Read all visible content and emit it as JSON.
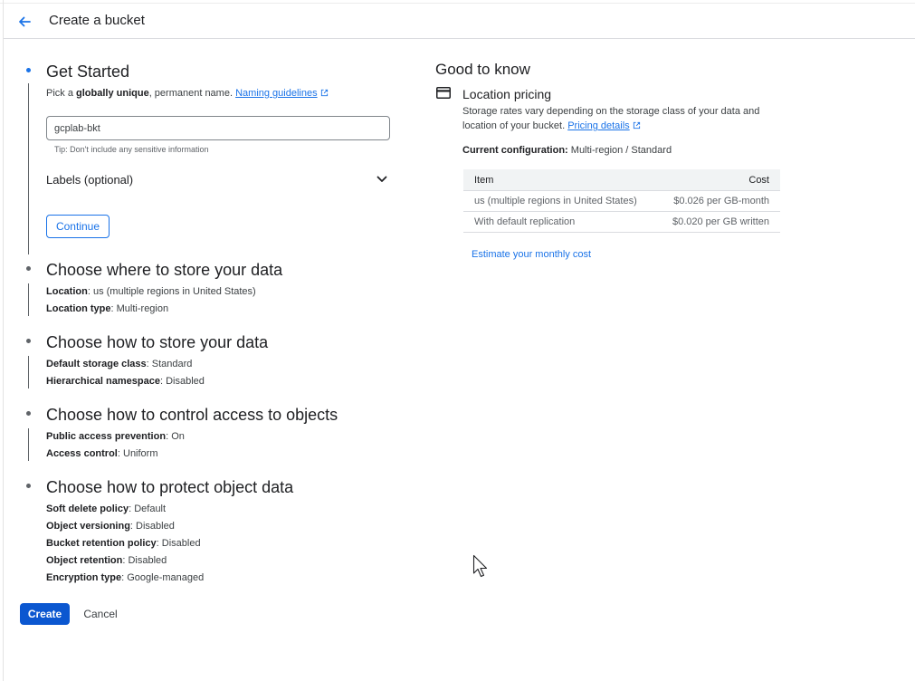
{
  "header": {
    "title": "Create a bucket"
  },
  "get_started": {
    "title": "Get Started",
    "desc_prefix": "Pick a ",
    "desc_bold": "globally unique",
    "desc_suffix": ", permanent name.",
    "naming_link": "Naming guidelines",
    "bucket_name_value": "gcplab-bkt",
    "tip": "Tip: Don't include any sensitive information",
    "labels_toggle": "Labels (optional)",
    "continue_label": "Continue"
  },
  "steps": [
    {
      "title": "Choose where to store your data",
      "fields": [
        {
          "label": "Location",
          "value": "us (multiple regions in United States)"
        },
        {
          "label": "Location type",
          "value": "Multi-region"
        }
      ]
    },
    {
      "title": "Choose how to store your data",
      "fields": [
        {
          "label": "Default storage class",
          "value": "Standard"
        },
        {
          "label": "Hierarchical namespace",
          "value": "Disabled"
        }
      ]
    },
    {
      "title": "Choose how to control access to objects",
      "fields": [
        {
          "label": "Public access prevention",
          "value": "On"
        },
        {
          "label": "Access control",
          "value": "Uniform"
        }
      ]
    },
    {
      "title": "Choose how to protect object data",
      "fields": [
        {
          "label": "Soft delete policy",
          "value": "Default"
        },
        {
          "label": "Object versioning",
          "value": "Disabled"
        },
        {
          "label": "Bucket retention policy",
          "value": "Disabled"
        },
        {
          "label": "Object retention",
          "value": "Disabled"
        },
        {
          "label": "Encryption type",
          "value": "Google-managed"
        }
      ]
    }
  ],
  "actions": {
    "create_label": "Create",
    "cancel_label": "Cancel"
  },
  "good_to_know": {
    "title": "Good to know",
    "location_pricing": {
      "title": "Location pricing",
      "desc": "Storage rates vary depending on the storage class of your data and location of your bucket.",
      "pricing_link": "Pricing details"
    },
    "current_config_label": "Current configuration:",
    "current_config_value": "Multi-region / Standard",
    "table": {
      "headers": [
        "Item",
        "Cost"
      ],
      "rows": [
        [
          "us (multiple regions in United States)",
          "$0.026 per GB-month"
        ],
        [
          "With default replication",
          "$0.020 per GB written"
        ]
      ]
    },
    "estimate_link": "Estimate your monthly cost"
  },
  "icons": {
    "back": "arrow-back-icon",
    "external": "external-link-icon",
    "chevron": "chevron-down-icon",
    "card": "credit-card-icon"
  },
  "colors": {
    "accent": "#1a73e8",
    "primary_button": "#0b57d0"
  }
}
